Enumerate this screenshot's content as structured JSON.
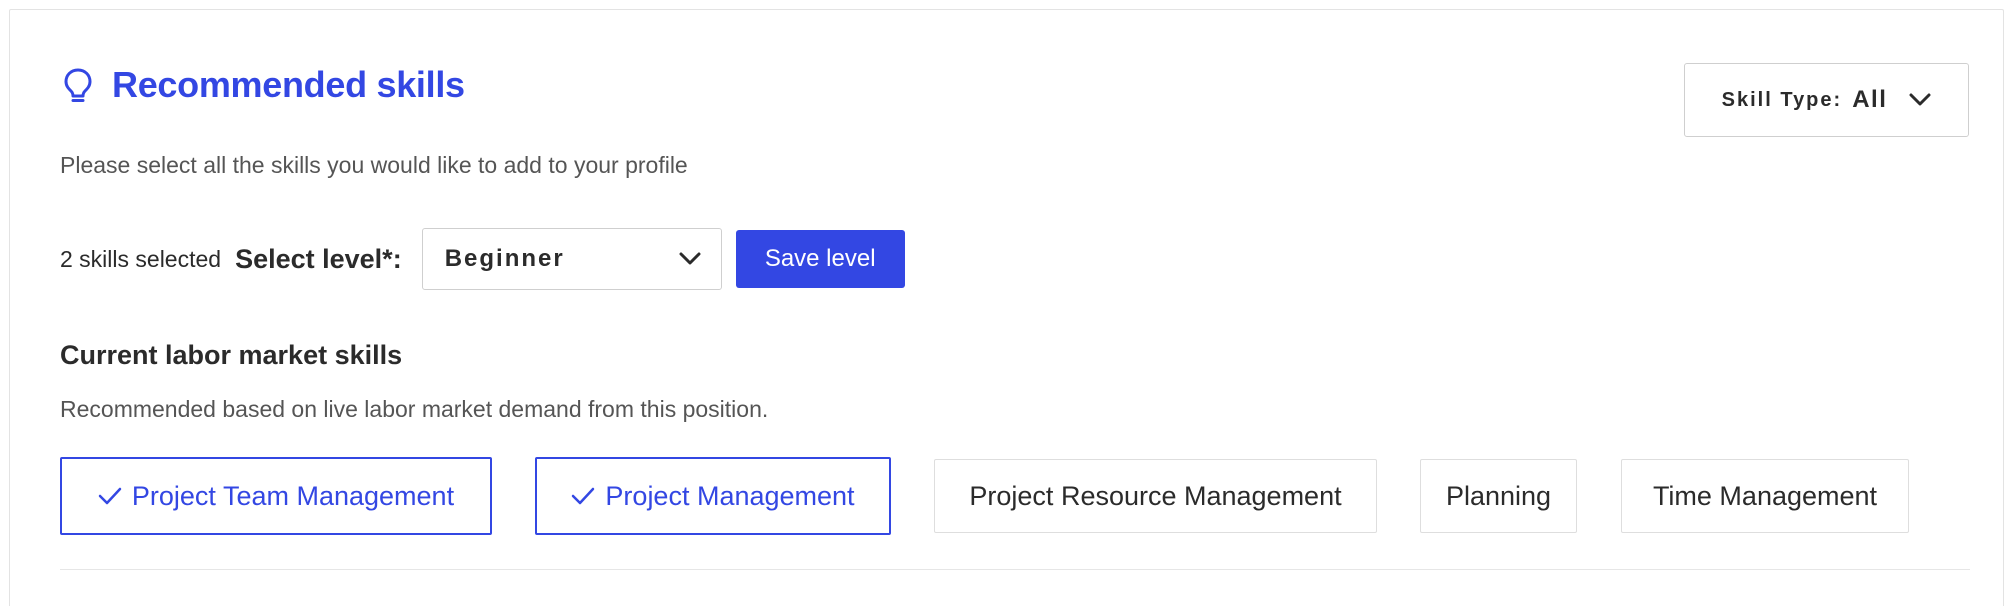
{
  "header": {
    "title": "Recommended skills",
    "icon": "lightbulb-icon",
    "subtitle": "Please select all the skills you would like to add to your profile"
  },
  "skill_type_filter": {
    "label": "Skill Type:",
    "value": "All"
  },
  "level": {
    "selected_count": "2 skills selected",
    "label": "Select level*:",
    "value": "Beginner",
    "save_label": "Save level"
  },
  "section": {
    "title": "Current labor market skills",
    "subtitle": "Recommended based on live labor market demand from this position."
  },
  "skills": [
    {
      "label": "Project Team Management",
      "selected": true
    },
    {
      "label": "Project Management",
      "selected": true
    },
    {
      "label": "Project Resource Management",
      "selected": false
    },
    {
      "label": "Planning",
      "selected": false
    },
    {
      "label": "Time Management",
      "selected": false
    }
  ],
  "colors": {
    "accent": "#3347e3",
    "text": "#2b2b2b",
    "muted": "#555555",
    "border": "#dedede"
  }
}
